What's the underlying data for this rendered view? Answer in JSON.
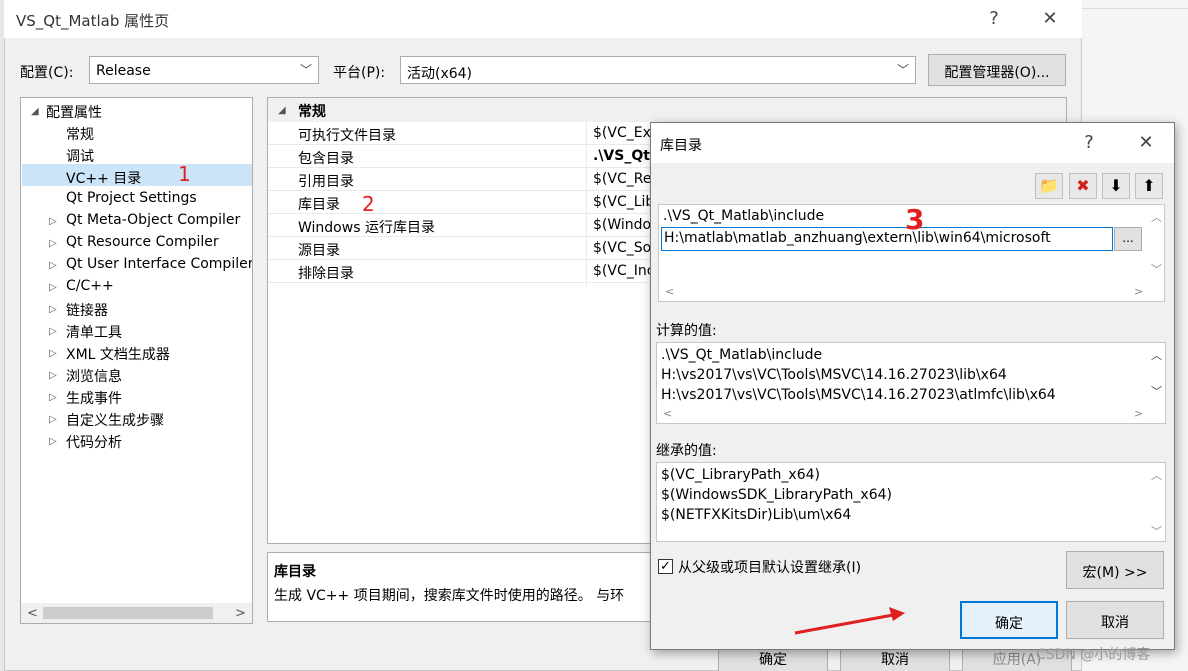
{
  "window": {
    "title": "VS_Qt_Matlab 属性页",
    "help": "?",
    "close": "✕"
  },
  "config": {
    "label": "配置(C):",
    "value": "Release",
    "platform_label": "平台(P):",
    "platform_value": "活动(x64)",
    "manager_button": "配置管理器(O)..."
  },
  "tree": {
    "root": "配置属性",
    "items": [
      {
        "label": "常规",
        "expandable": false
      },
      {
        "label": "调试",
        "expandable": false
      },
      {
        "label": "VC++ 目录",
        "expandable": false,
        "selected": true
      },
      {
        "label": "Qt Project Settings",
        "expandable": false
      },
      {
        "label": "Qt Meta-Object Compiler",
        "expandable": true
      },
      {
        "label": "Qt Resource Compiler",
        "expandable": true
      },
      {
        "label": "Qt User Interface Compiler",
        "expandable": true
      },
      {
        "label": "C/C++",
        "expandable": true
      },
      {
        "label": "链接器",
        "expandable": true
      },
      {
        "label": "清单工具",
        "expandable": true
      },
      {
        "label": "XML 文档生成器",
        "expandable": true
      },
      {
        "label": "浏览信息",
        "expandable": true
      },
      {
        "label": "生成事件",
        "expandable": true
      },
      {
        "label": "自定义生成步骤",
        "expandable": true
      },
      {
        "label": "代码分析",
        "expandable": true
      }
    ]
  },
  "grid": {
    "category": "常规",
    "rows": [
      {
        "key": "可执行文件目录",
        "value": "$(VC_Ex"
      },
      {
        "key": "包含目录",
        "value": ".\\VS_Qt",
        "bold": true
      },
      {
        "key": "引用目录",
        "value": "$(VC_Re"
      },
      {
        "key": "库目录",
        "value": "$(VC_Lib"
      },
      {
        "key": "Windows 运行库目录",
        "value": "$(Windo"
      },
      {
        "key": "源目录",
        "value": "$(VC_So"
      },
      {
        "key": "排除目录",
        "value": "$(VC_Inc"
      }
    ]
  },
  "description": {
    "title": "库目录",
    "text": "生成 VC++ 项目期间，搜索库文件时使用的路径。 与环"
  },
  "main_buttons": {
    "ok": "确定",
    "cancel": "取消",
    "apply": "应用(A)"
  },
  "dialog": {
    "title": "库目录",
    "help": "?",
    "close": "✕",
    "entries": [
      ".\\VS_Qt_Matlab\\include",
      "H:\\matlab\\matlab_anzhuang\\extern\\lib\\win64\\microsoft"
    ],
    "browse": "...",
    "computed_label": "计算的值:",
    "computed": [
      ".\\VS_Qt_Matlab\\include",
      "H:\\vs2017\\vs\\VC\\Tools\\MSVC\\14.16.27023\\lib\\x64",
      "H:\\vs2017\\vs\\VC\\Tools\\MSVC\\14.16.27023\\atlmfc\\lib\\x64"
    ],
    "inherited_label": "继承的值:",
    "inherited": [
      "$(VC_LibraryPath_x64)",
      "$(WindowsSDK_LibraryPath_x64)",
      "$(NETFXKitsDir)Lib\\um\\x64"
    ],
    "inherit_checkbox": "从父级或项目默认设置继承(I)",
    "inherit_checked": true,
    "macro_button": "宏(M) >>",
    "ok": "确定",
    "cancel": "取消"
  },
  "watermark": "CSDN @小的博客",
  "annotations": {
    "one": "1",
    "two": "2",
    "three": "3"
  },
  "colors": {
    "selection": "#cce4f7",
    "accent": "#0078d7",
    "annotation": "#e02020"
  }
}
